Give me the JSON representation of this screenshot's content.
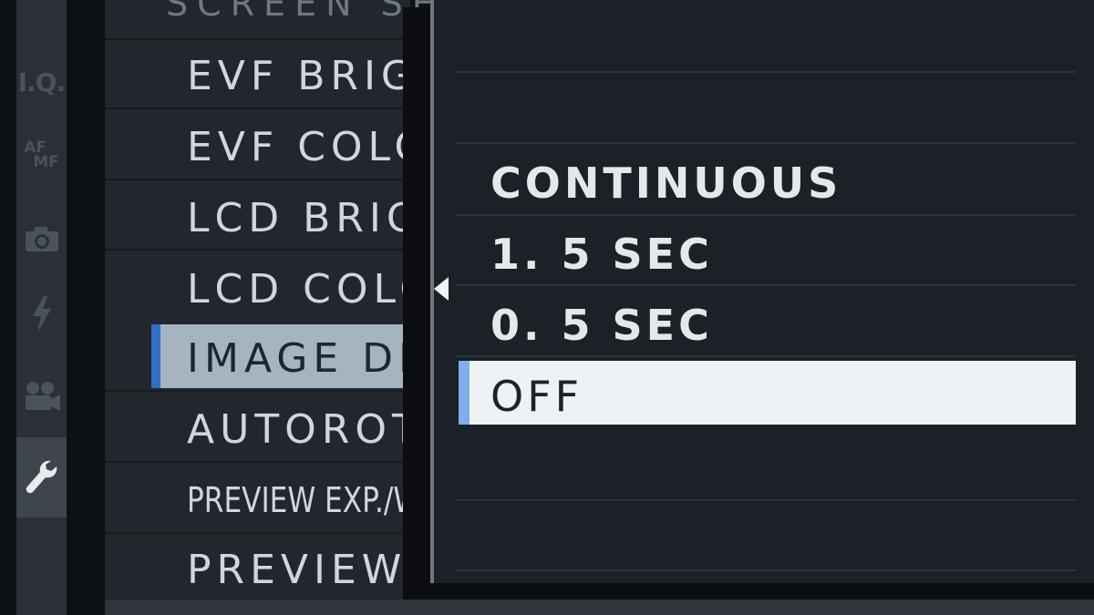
{
  "screen": {
    "section_title": "SCREEN SE"
  },
  "tabs": [
    {
      "label": "I.Q.",
      "icon": "image-quality-icon",
      "active": false
    },
    {
      "label_top": "AF",
      "label_bottom": "MF",
      "icon": "af-mf-icon",
      "active": false
    },
    {
      "icon": "camera-icon",
      "active": false
    },
    {
      "icon": "flash-icon",
      "active": false
    },
    {
      "icon": "movie-camera-icon",
      "active": false
    },
    {
      "icon": "wrench-icon",
      "active": true
    }
  ],
  "menu": {
    "items": [
      {
        "label": "EVF BRIG"
      },
      {
        "label": "EVF COLO"
      },
      {
        "label": "LCD BRIG"
      },
      {
        "label": "LCD COLO"
      },
      {
        "label": "IMAGE DI",
        "selected": true
      },
      {
        "label": "AUTOROTA"
      },
      {
        "label": "PREVIEW EXP./W",
        "condensed": true
      },
      {
        "label": "PREVIEW"
      }
    ]
  },
  "popup": {
    "options": [
      {
        "label": "CONTINUOUS"
      },
      {
        "label": "1. 5 SEC"
      },
      {
        "label": "0. 5 SEC"
      },
      {
        "label": "OFF",
        "selected": true
      }
    ]
  },
  "colors": {
    "selection_accent": "#2f6fc8",
    "option_accent": "#7fb0ec",
    "selected_row_bg": "#a6b4c2",
    "selected_option_bg": "#eef2f6"
  }
}
